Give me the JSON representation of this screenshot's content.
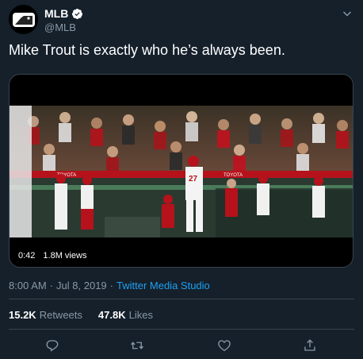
{
  "account": {
    "display_name": "MLB",
    "handle": "@MLB",
    "verified": true
  },
  "tweet": {
    "text": "Mike Trout is exactly who he’s always been."
  },
  "video": {
    "duration": "0:42",
    "views": "1.8M views",
    "scoreboard_text": "TOYOTA",
    "jersey_number": "27"
  },
  "meta": {
    "time": "8:00 AM",
    "separator1": "·",
    "date": "Jul 8, 2019",
    "separator2": "·",
    "source": "Twitter Media Studio"
  },
  "stats": {
    "retweets_count": "15.2K",
    "retweets_label": "Retweets",
    "likes_count": "47.8K",
    "likes_label": "Likes"
  },
  "icons": {
    "reply": "reply-icon",
    "retweet": "retweet-icon",
    "like": "heart-icon",
    "share": "share-icon"
  },
  "colors": {
    "background": "#15202b",
    "secondary_text": "#8899a6",
    "link": "#1da1f2",
    "divider": "#38444d"
  }
}
